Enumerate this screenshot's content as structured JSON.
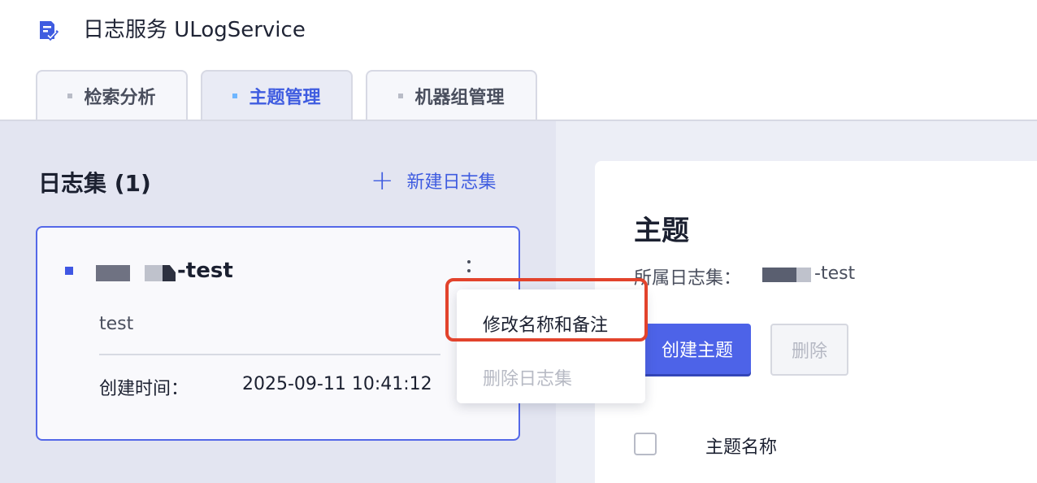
{
  "app": {
    "title": "日志服务 ULogService"
  },
  "tabs": [
    {
      "label": "检索分析",
      "active": false
    },
    {
      "label": "主题管理",
      "active": true
    },
    {
      "label": "机器组管理",
      "active": false
    }
  ],
  "logsets": {
    "title": "日志集 (1)",
    "new_button": "新建日志集",
    "card": {
      "name_suffix": "-test",
      "description": "test",
      "created_label": "创建时间：",
      "created_value": "2025-09-11 10:41:12"
    },
    "menu": {
      "items": [
        {
          "label": "修改名称和备注",
          "disabled": false
        },
        {
          "label": "删除日志集",
          "disabled": true
        }
      ]
    }
  },
  "topics": {
    "title": "主题",
    "logset_label": "所属日志集：",
    "logset_name_suffix": "-test",
    "create_button": "创建主题",
    "delete_button": "删除",
    "columns": [
      "主题名称"
    ]
  },
  "colors": {
    "accent": "#4d63e8",
    "highlight": "#e2432c"
  }
}
